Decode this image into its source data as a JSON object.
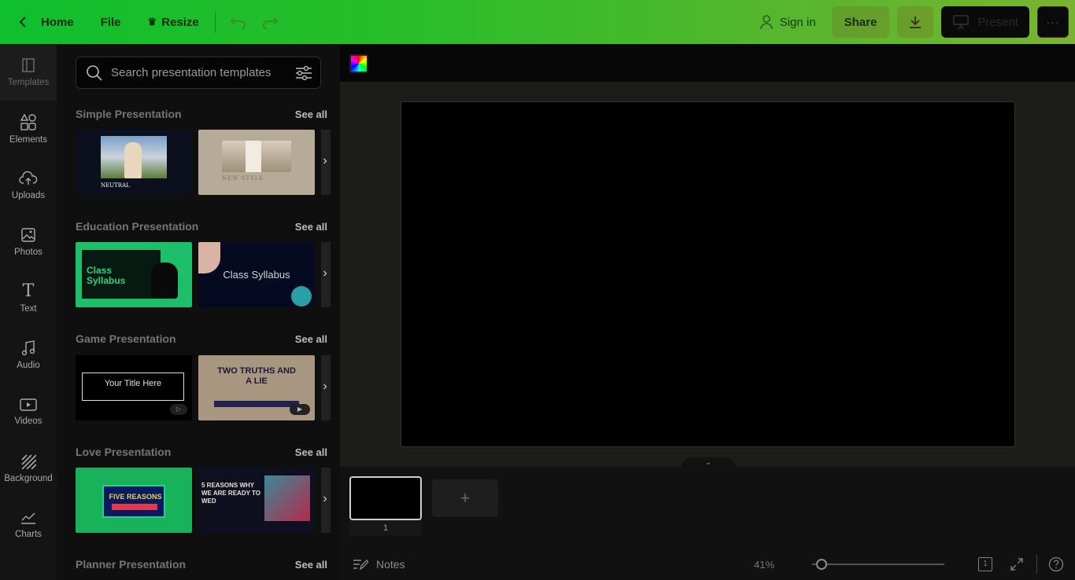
{
  "topbar": {
    "home_label": "Home",
    "file_label": "File",
    "resize_label": "Resize",
    "signin_label": "Sign in",
    "share_label": "Share",
    "present_label": "Present"
  },
  "rail": {
    "items": [
      {
        "label": "Templates",
        "icon": "template-icon"
      },
      {
        "label": "Elements",
        "icon": "shapes-icon"
      },
      {
        "label": "Uploads",
        "icon": "cloud-upload-icon"
      },
      {
        "label": "Photos",
        "icon": "image-icon"
      },
      {
        "label": "Text",
        "icon": "text-icon"
      },
      {
        "label": "Audio",
        "icon": "music-note-icon"
      },
      {
        "label": "Videos",
        "icon": "video-icon"
      },
      {
        "label": "Background",
        "icon": "background-pattern-icon"
      },
      {
        "label": "Charts",
        "icon": "line-chart-icon"
      }
    ]
  },
  "panel": {
    "search_placeholder": "Search presentation templates",
    "see_all": "See all",
    "sections": [
      {
        "title": "Simple Presentation",
        "thumbs": [
          {
            "caption": "NEUTRAL",
            "style": "dark"
          },
          {
            "caption": "NEW STYLE",
            "style": "beige"
          }
        ]
      },
      {
        "title": "Education Presentation",
        "thumbs": [
          {
            "caption": "Class Syllabus",
            "style": "green"
          },
          {
            "caption": "Class Syllabus",
            "style": "navy"
          }
        ]
      },
      {
        "title": "Game Presentation",
        "thumbs": [
          {
            "caption": "Your Title Here",
            "style": "black"
          },
          {
            "caption": "TWO TRUTHS AND A LIE",
            "style": "collage"
          }
        ]
      },
      {
        "title": "Love Presentation",
        "thumbs": [
          {
            "caption": "FIVE REASONS",
            "style": "green"
          },
          {
            "caption": "5 REASONS WHY WE ARE READY TO WED",
            "style": "dark"
          }
        ]
      },
      {
        "title": "Planner Presentation",
        "thumbs": []
      }
    ]
  },
  "pages": {
    "current_page_number": "1"
  },
  "footer": {
    "notes_label": "Notes",
    "zoom": "41%",
    "page_count": "1",
    "zoom_level": 0.05
  },
  "colors": {
    "topbar_start": "#0fbf2c",
    "topbar_end": "#7ab430",
    "canvas_border": "#1b3a3a"
  }
}
